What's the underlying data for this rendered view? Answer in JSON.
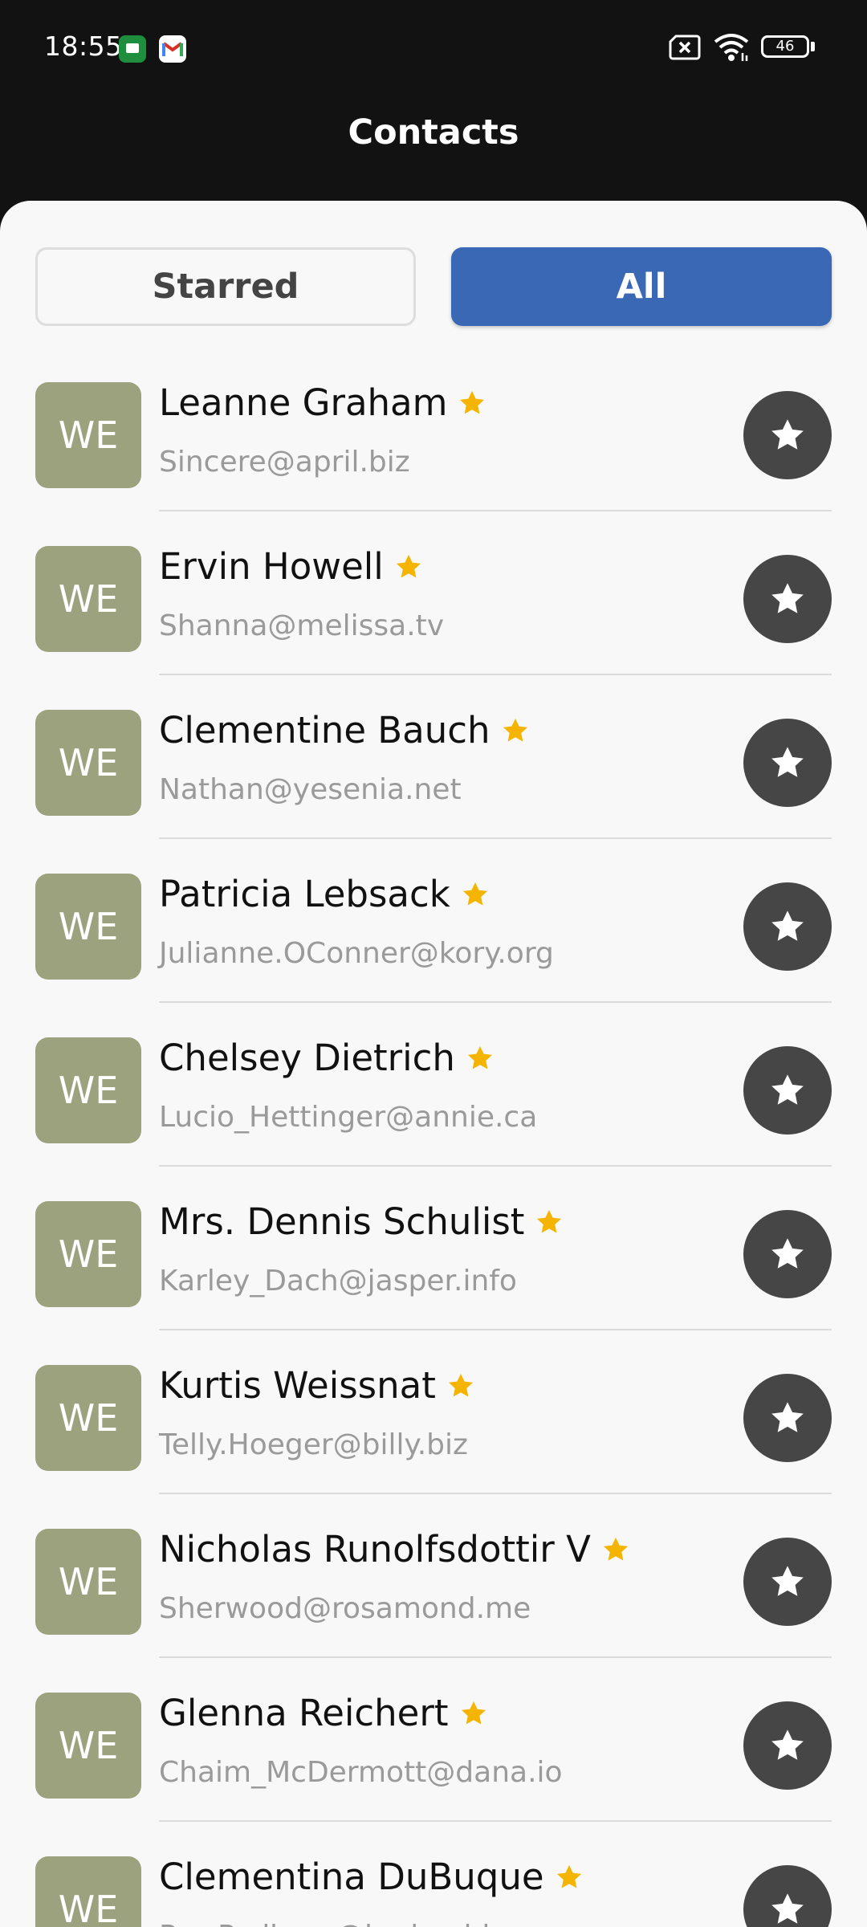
{
  "status_bar": {
    "time": "18:55",
    "battery": "46"
  },
  "header": {
    "title": "Contacts"
  },
  "tabs": {
    "starred_label": "Starred",
    "all_label": "All",
    "selected": "All"
  },
  "colors": {
    "accent": "#3a68b5",
    "avatar_bg": "#9ca27e",
    "favorite_star": "#f5b400",
    "star_button_bg": "#464646"
  },
  "contacts": [
    {
      "initials": "WE",
      "name": "Leanne Graham",
      "email": "Sincere@april.biz",
      "favorite": true
    },
    {
      "initials": "WE",
      "name": "Ervin Howell",
      "email": "Shanna@melissa.tv",
      "favorite": true
    },
    {
      "initials": "WE",
      "name": "Clementine Bauch",
      "email": "Nathan@yesenia.net",
      "favorite": true
    },
    {
      "initials": "WE",
      "name": "Patricia Lebsack",
      "email": "Julianne.OConner@kory.org",
      "favorite": true
    },
    {
      "initials": "WE",
      "name": "Chelsey Dietrich",
      "email": "Lucio_Hettinger@annie.ca",
      "favorite": true
    },
    {
      "initials": "WE",
      "name": "Mrs. Dennis Schulist",
      "email": "Karley_Dach@jasper.info",
      "favorite": true
    },
    {
      "initials": "WE",
      "name": "Kurtis Weissnat",
      "email": "Telly.Hoeger@billy.biz",
      "favorite": true
    },
    {
      "initials": "WE",
      "name": "Nicholas Runolfsdottir V",
      "email": "Sherwood@rosamond.me",
      "favorite": true
    },
    {
      "initials": "WE",
      "name": "Glenna Reichert",
      "email": "Chaim_McDermott@dana.io",
      "favorite": true
    },
    {
      "initials": "WE",
      "name": "Clementina DuBuque",
      "email": "Rey.Padberg@karina.biz",
      "favorite": true
    }
  ]
}
